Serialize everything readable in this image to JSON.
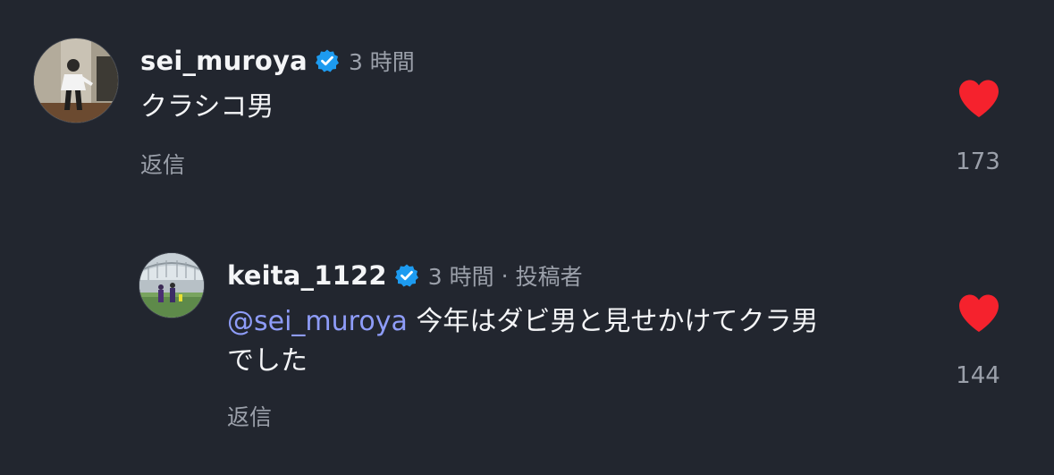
{
  "comments": [
    {
      "username": "sei_muroya",
      "time": "3 時間",
      "text": "クラシコ男",
      "reply_label": "返信",
      "like_count": "173"
    }
  ],
  "reply_comment": {
    "username": "keita_1122",
    "time": "3 時間",
    "separator": "·",
    "author_badge": "投稿者",
    "mention": "@sei_muroya",
    "text_line1": " 今年はダビ男と見せかけてクラ男",
    "text_line2": "でした",
    "reply_label": "返信",
    "like_count": "144"
  },
  "colors": {
    "background": "#22262f",
    "heart": "#f5222d",
    "verified": "#1d9bf0",
    "mention": "#8e9cf8",
    "secondary_text": "#9ba0aa"
  },
  "icons": [
    "verified-badge-icon",
    "heart-icon"
  ]
}
